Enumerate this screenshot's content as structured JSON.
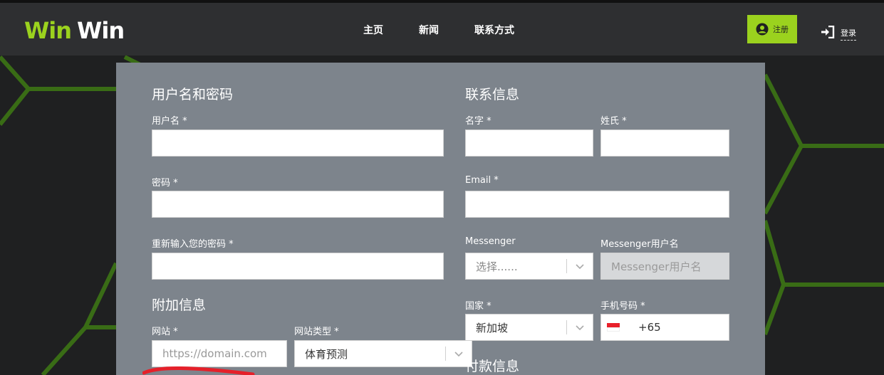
{
  "brand": {
    "part1": "Win",
    "part2": "Win",
    "accent": "#9bd21e"
  },
  "nav": {
    "home": "主页",
    "news": "新闻",
    "contact": "联系方式"
  },
  "auth": {
    "register": "注册",
    "login": "登录"
  },
  "left": {
    "section_title": "用户名和密码",
    "username_label": "用户名 *",
    "password_label": "密码 *",
    "confirm_label": "重新输入您的密码 *",
    "extra_title": "附加信息",
    "website_label": "网站 *",
    "website_placeholder": "https://domain.com",
    "site_type_label": "网站类型 *",
    "site_type_value": "体育预测"
  },
  "right": {
    "section_title": "联系信息",
    "first_name_label": "名字 *",
    "last_name_label": "姓氏 *",
    "email_label": "Email *",
    "messenger_label": "Messenger",
    "messenger_value": "选择......",
    "messenger_user_label": "Messenger用户名",
    "messenger_user_placeholder": "Messenger用户名",
    "country_label": "国家 *",
    "country_value": "新加坡",
    "phone_label": "手机号码 *",
    "phone_code": "+65",
    "payment_title": "付款信息"
  }
}
